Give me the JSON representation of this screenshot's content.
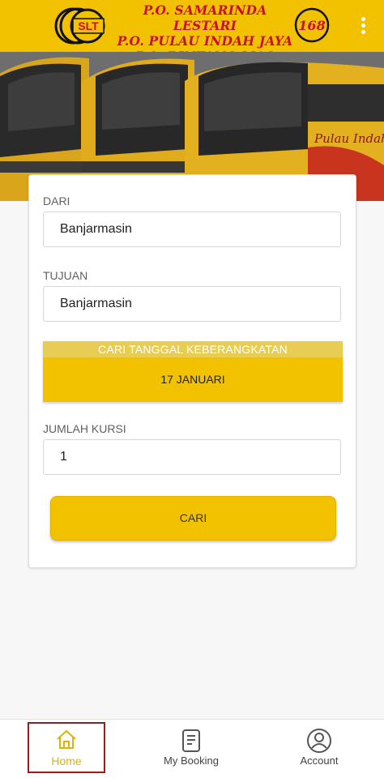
{
  "header": {
    "lines": [
      "P.O. SAMARINDA LESTARI",
      "P.O. PULAU INDAH JAYA",
      "P.O. BINTANG MAS"
    ],
    "logo_left_text": "SLT",
    "logo_right_text": "168",
    "menu_icon": "more-vertical-icon",
    "colors": {
      "background": "#f2c200",
      "title": "#c8102e"
    }
  },
  "banner": {
    "bus_lettering": "Pulau Indah Jaya"
  },
  "form": {
    "from_label": "DARI",
    "from_value": "Banjarmasin",
    "to_label": "TUJUAN",
    "to_value": "Banjarmasin",
    "date_header": "CARI TANGGAL KEBERANGKATAN",
    "date_value": "17 JANUARI",
    "seats_label": "JUMLAH KURSI",
    "seats_value": "1",
    "search_button": "CARI"
  },
  "bottom_nav": {
    "items": [
      {
        "label": "Home",
        "icon": "home-icon",
        "active": true
      },
      {
        "label": "My Booking",
        "icon": "booking-icon",
        "active": false
      },
      {
        "label": "Account",
        "icon": "account-icon",
        "active": false
      }
    ],
    "active_color": "#e0b300"
  }
}
